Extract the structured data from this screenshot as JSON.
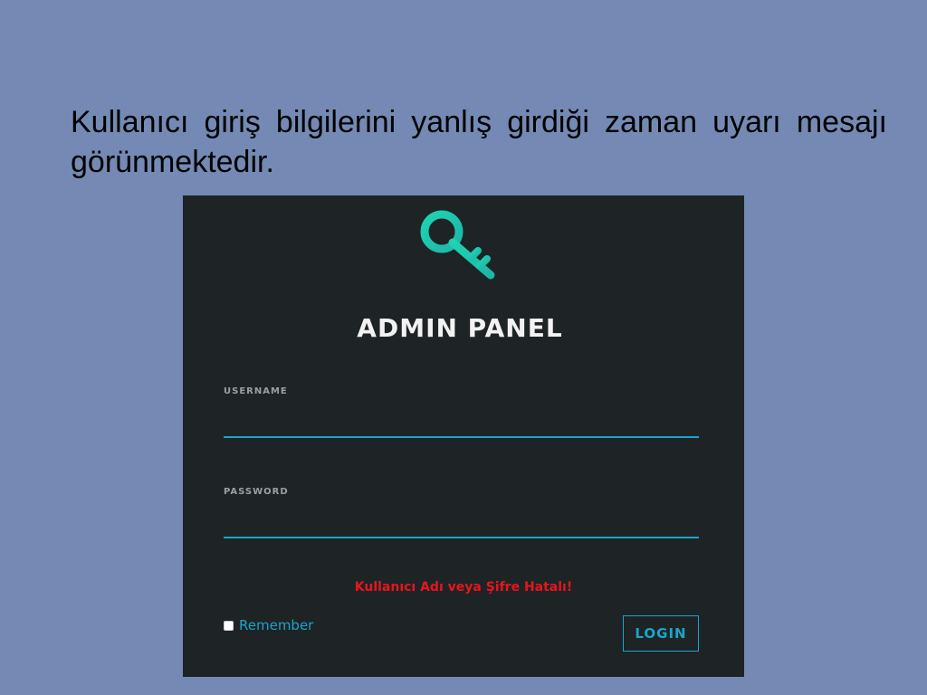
{
  "caption": "Kullanıcı giriş bilgilerini yanlış girdiği zaman uyarı mesajı görünmektedir.",
  "panel": {
    "logo_icon": "key-icon",
    "title": "ADMIN PANEL",
    "username_label": "USERNAME",
    "username_value": "",
    "password_label": "PASSWORD",
    "password_value": "",
    "error_message": "Kullanıcı Adı veya Şifre Hatalı!",
    "remember_label": "Remember",
    "remember_checked": false,
    "login_label": "LOGIN"
  },
  "colors": {
    "background": "#748ab4",
    "panel": "#1e2326",
    "accent": "#1aa6c8",
    "logo_green": "#2ee0a0",
    "error": "#e8151b"
  }
}
